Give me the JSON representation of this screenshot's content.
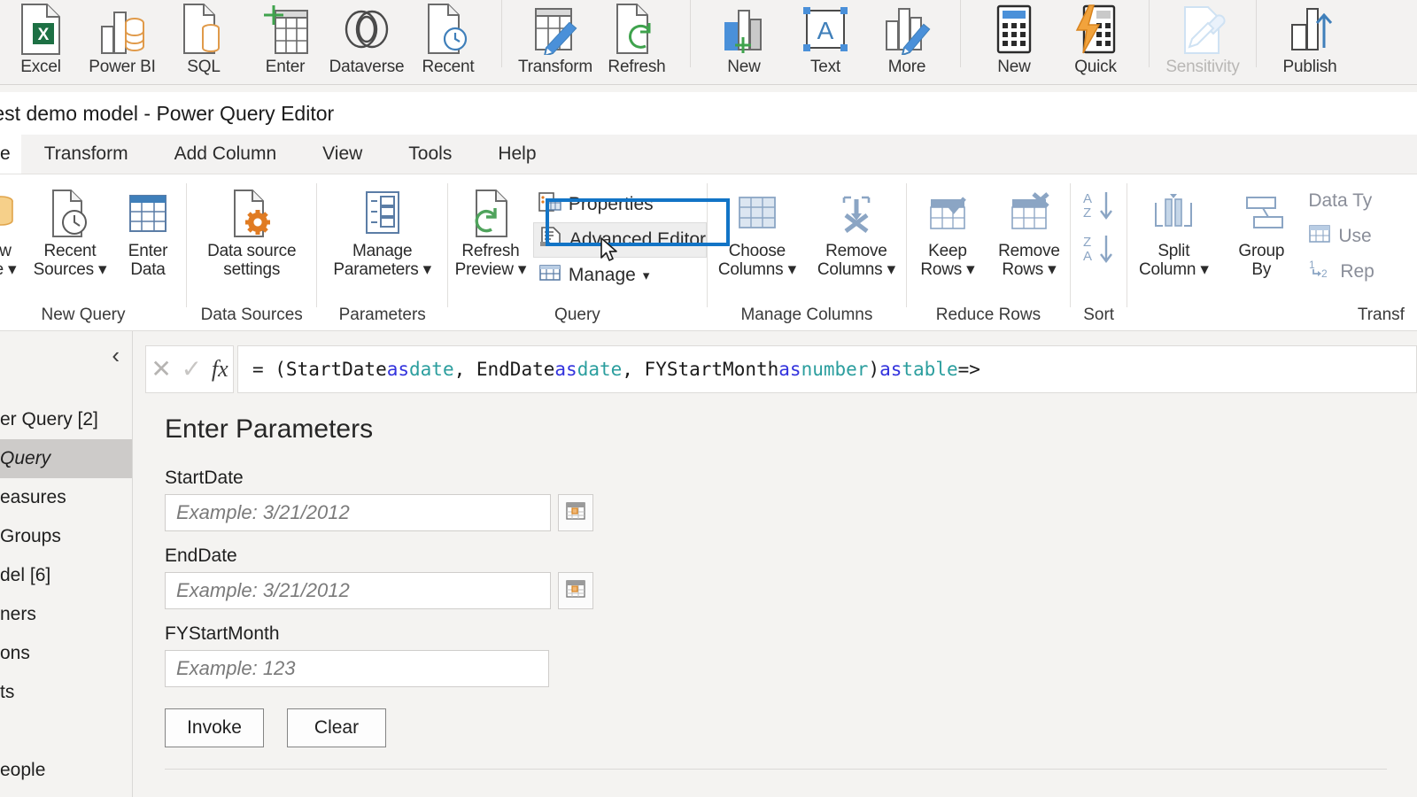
{
  "host_ribbon": {
    "groups": [
      {
        "name": "data-sources-group",
        "buttons": [
          {
            "label": "Excel",
            "icon": "excel-file-icon"
          },
          {
            "label": "Power BI",
            "icon": "power-bi-dataset-icon"
          },
          {
            "label": "SQL",
            "icon": "sql-database-icon"
          },
          {
            "label": "Enter",
            "icon": "enter-data-table-icon"
          },
          {
            "label": "Dataverse",
            "icon": "dataverse-icon"
          },
          {
            "label": "Recent",
            "icon": "recent-sources-clock-icon"
          }
        ]
      },
      {
        "name": "queries-group",
        "buttons": [
          {
            "label": "Transform",
            "icon": "transform-data-pencil-icon"
          },
          {
            "label": "Refresh",
            "icon": "refresh-page-icon"
          }
        ]
      },
      {
        "name": "insert-group",
        "buttons": [
          {
            "label": "New",
            "icon": "new-visual-icon"
          },
          {
            "label": "Text",
            "icon": "text-box-icon"
          },
          {
            "label": "More",
            "icon": "more-visuals-icon"
          }
        ]
      },
      {
        "name": "calculations-group",
        "buttons": [
          {
            "label": "New",
            "icon": "new-measure-calculator-icon"
          },
          {
            "label": "Quick",
            "icon": "quick-measure-lightning-icon"
          }
        ]
      },
      {
        "name": "sensitivity-group",
        "buttons": [
          {
            "label": "Sensitivity",
            "icon": "sensitivity-label-icon",
            "disabled": true
          }
        ]
      },
      {
        "name": "share-group",
        "buttons": [
          {
            "label": "Publish",
            "icon": "publish-upload-icon"
          }
        ]
      }
    ]
  },
  "pq_window": {
    "title": "test demo model - Power Query Editor",
    "tabs": [
      {
        "label": "e",
        "active": true,
        "name": "tab-home-clipped"
      },
      {
        "label": "Transform",
        "active": false,
        "name": "tab-transform"
      },
      {
        "label": "Add Column",
        "active": false,
        "name": "tab-add-column"
      },
      {
        "label": "View",
        "active": false,
        "name": "tab-view"
      },
      {
        "label": "Tools",
        "active": false,
        "name": "tab-tools"
      },
      {
        "label": "Help",
        "active": false,
        "name": "tab-help"
      }
    ]
  },
  "pq_ribbon": {
    "new_query": {
      "group_label": "New Query",
      "clipped_button": {
        "line1": "w",
        "line2": "e"
      },
      "buttons": [
        {
          "line1": "Recent",
          "line2": "Sources",
          "icon": "recent-sources-clock-icon",
          "dropdown": true
        },
        {
          "line1": "Enter",
          "line2": "Data",
          "icon": "enter-data-grid-icon",
          "dropdown": false
        }
      ]
    },
    "data_sources": {
      "group_label": "Data Sources",
      "buttons": [
        {
          "line1": "Data source",
          "line2": "settings",
          "icon": "data-source-settings-gear-icon"
        }
      ]
    },
    "parameters": {
      "group_label": "Parameters",
      "buttons": [
        {
          "line1": "Manage",
          "line2": "Parameters",
          "icon": "manage-parameters-list-icon",
          "dropdown": true
        }
      ]
    },
    "query": {
      "group_label": "Query",
      "refresh": {
        "line1": "Refresh",
        "line2": "Preview",
        "icon": "refresh-preview-icon",
        "dropdown": true
      },
      "rows": [
        {
          "label": "Properties",
          "icon": "properties-icon",
          "highlighted": false
        },
        {
          "label": "Advanced Editor",
          "icon": "advanced-editor-icon",
          "highlighted": true
        },
        {
          "label": "Manage",
          "icon": "manage-grid-icon",
          "dropdown": true,
          "highlighted": false
        }
      ]
    },
    "manage_columns": {
      "group_label": "Manage Columns",
      "buttons": [
        {
          "line1": "Choose",
          "line2": "Columns",
          "icon": "choose-columns-icon",
          "dropdown": true
        },
        {
          "line1": "Remove",
          "line2": "Columns",
          "icon": "remove-columns-icon",
          "dropdown": true
        }
      ]
    },
    "reduce_rows": {
      "group_label": "Reduce Rows",
      "buttons": [
        {
          "line1": "Keep",
          "line2": "Rows",
          "icon": "keep-rows-icon",
          "dropdown": true
        },
        {
          "line1": "Remove",
          "line2": "Rows",
          "icon": "remove-rows-icon",
          "dropdown": true
        }
      ]
    },
    "sort": {
      "group_label": "Sort",
      "buttons": [
        {
          "label": "sort-ascending",
          "icon": "sort-az-icon"
        },
        {
          "label": "sort-descending",
          "icon": "sort-za-icon"
        }
      ]
    },
    "transform": {
      "group_label": "Transf",
      "buttons": [
        {
          "line1": "Split",
          "line2": "Column",
          "icon": "split-column-icon",
          "dropdown": true
        },
        {
          "line1": "Group",
          "line2": "By",
          "icon": "group-by-icon",
          "dropdown": false
        }
      ],
      "rows": [
        {
          "label": "Data Ty",
          "icon": "data-type-icon"
        },
        {
          "label": "Use",
          "icon": "use-first-row-as-headers-icon"
        },
        {
          "label": "Rep",
          "icon": "replace-values-icon"
        }
      ]
    },
    "highlight_color": "#1274c6"
  },
  "queries_pane": {
    "collapse_icon": "chevron-left-icon",
    "items": [
      {
        "label": "er Query [2]",
        "selected": false,
        "name": "queries-group-power-query"
      },
      {
        "label": "Query",
        "selected": true,
        "name": "query-item-selected"
      },
      {
        "label": "easures",
        "selected": false,
        "name": "queries-item-measures"
      },
      {
        "label": " Groups",
        "selected": false,
        "name": "queries-item-groups"
      },
      {
        "label": "del [6]",
        "selected": false,
        "name": "queries-group-model"
      },
      {
        "label": "ners",
        "selected": false,
        "name": "queries-item-partners"
      },
      {
        "label": "ons",
        "selected": false,
        "name": "queries-item-regions"
      },
      {
        "label": "ts",
        "selected": false,
        "name": "queries-item-products"
      },
      {
        "label": "",
        "selected": false,
        "name": "queries-item-blank"
      },
      {
        "label": "eople",
        "selected": false,
        "name": "queries-item-people"
      }
    ]
  },
  "formula_bar": {
    "cancel_icon": "cancel-x-icon",
    "commit_icon": "commit-check-icon",
    "fx_icon": "fx-icon",
    "tokens": [
      {
        "text": "= (StartDate ",
        "kind": "plain"
      },
      {
        "text": "as",
        "kind": "keyword"
      },
      {
        "text": " ",
        "kind": "plain"
      },
      {
        "text": "date",
        "kind": "type"
      },
      {
        "text": ", EndDate ",
        "kind": "plain"
      },
      {
        "text": "as",
        "kind": "keyword"
      },
      {
        "text": " ",
        "kind": "plain"
      },
      {
        "text": "date",
        "kind": "type"
      },
      {
        "text": ", FYStartMonth ",
        "kind": "plain"
      },
      {
        "text": "as",
        "kind": "keyword"
      },
      {
        "text": " ",
        "kind": "plain"
      },
      {
        "text": "number",
        "kind": "type"
      },
      {
        "text": ") ",
        "kind": "plain"
      },
      {
        "text": "as",
        "kind": "keyword"
      },
      {
        "text": " ",
        "kind": "plain"
      },
      {
        "text": "table",
        "kind": "type"
      },
      {
        "text": " =>",
        "kind": "plain"
      }
    ],
    "full_text": "= (StartDate as date, EndDate as date, FYStartMonth as number) as table =>"
  },
  "parameters_form": {
    "title": "Enter Parameters",
    "fields": [
      {
        "label": "StartDate",
        "value": "",
        "placeholder": "Example: 3/21/2012",
        "has_calendar": true,
        "name": "startdate"
      },
      {
        "label": "EndDate",
        "value": "",
        "placeholder": "Example: 3/21/2012",
        "has_calendar": true,
        "name": "enddate"
      },
      {
        "label": "FYStartMonth",
        "value": "",
        "placeholder": "Example: 123",
        "has_calendar": false,
        "name": "fystartmonth"
      }
    ],
    "invoke_label": "Invoke",
    "clear_label": "Clear",
    "calendar_icon": "calendar-picker-icon"
  }
}
